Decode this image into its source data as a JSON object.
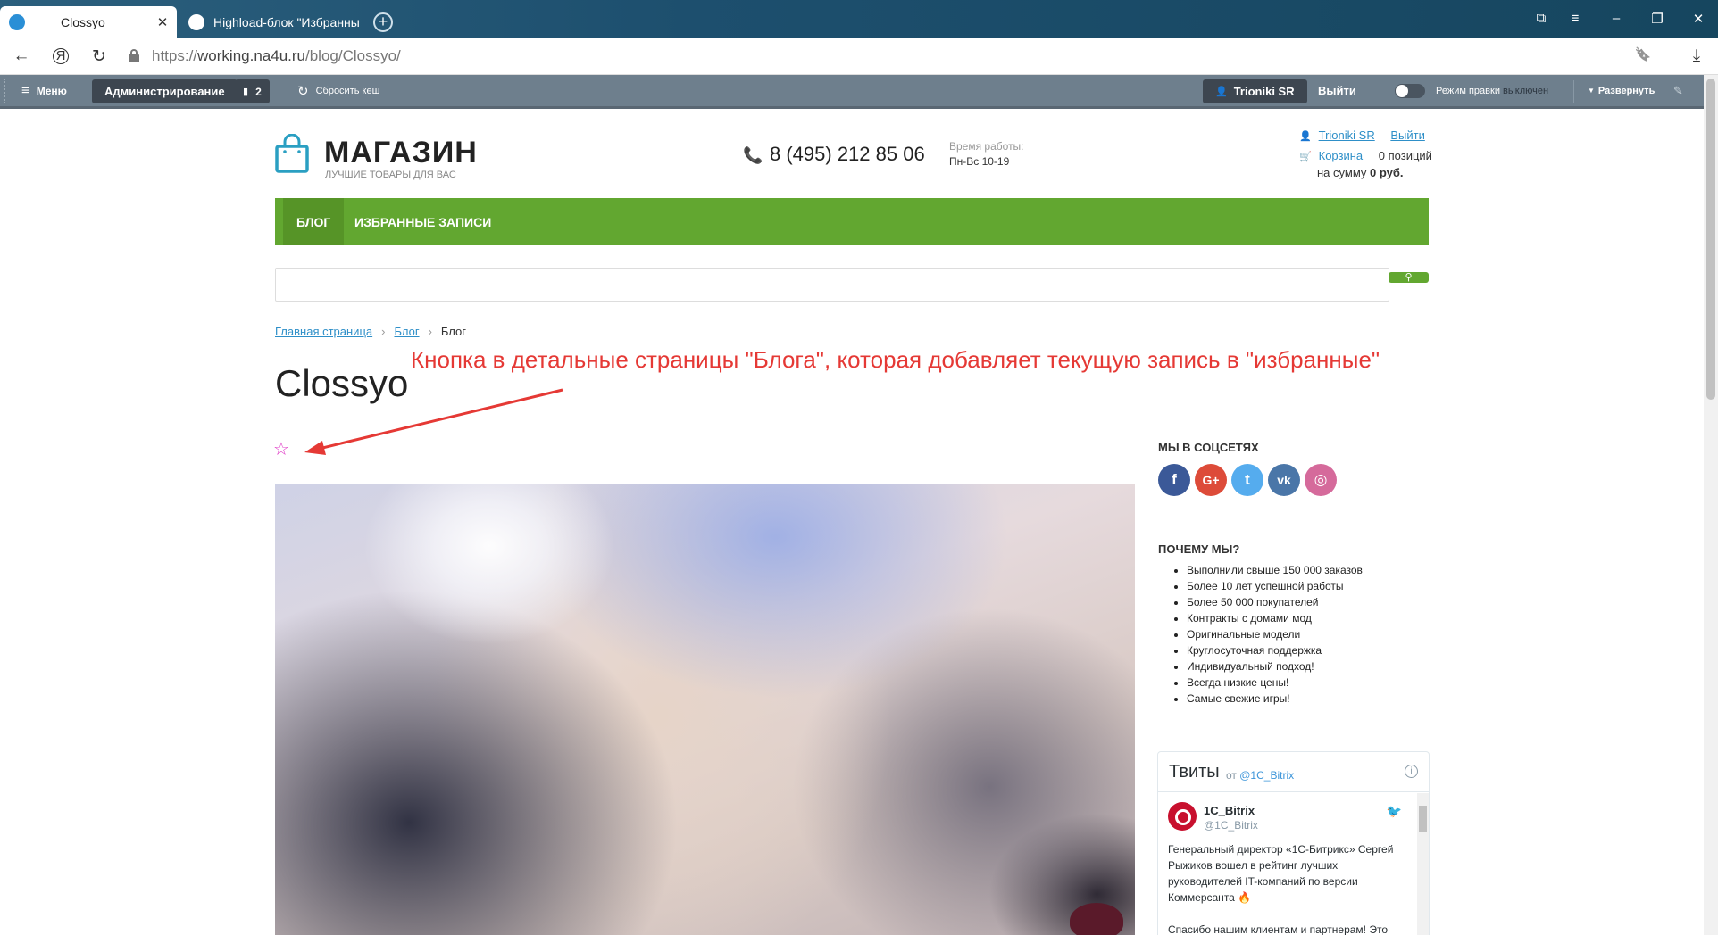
{
  "browser": {
    "tabs": [
      {
        "title": "Clossyo",
        "active": true
      },
      {
        "title": "Highload-блок \"Избранны",
        "active": false
      }
    ],
    "new_tab_label": "+",
    "url_protocol": "https://",
    "url_host": "working.na4u.ru",
    "url_path": "/blog/Clossyo/",
    "icons": [
      "back-arrow-icon",
      "yandex-icon",
      "reload-icon",
      "lock-icon",
      "bookmark-icon",
      "download-icon"
    ],
    "nav": {
      "back": "←",
      "yandex": "Я",
      "reload": "↻",
      "bookmark": "🔖",
      "download": "⤓"
    },
    "window": {
      "bookmarks": "⧉",
      "menu": "≡",
      "minimize": "–",
      "maximize": "❐",
      "close": "✕"
    }
  },
  "admin_panel": {
    "menu_label": "Меню",
    "admin_label": "Администрирование",
    "notifications_count": "2",
    "clear_cache_label": "Сбросить кеш",
    "user_label": "Trioniki SR",
    "logout_label": "Выйти",
    "edit_mode_label": "Режим правки",
    "edit_mode_state": "выключен",
    "expand_label": "Развернуть",
    "colors": {
      "bar": "#6e7f8d",
      "button": "#3d4650"
    }
  },
  "header": {
    "logo_title": "МАГАЗИН",
    "logo_subtitle": "ЛУЧШИЕ ТОВАРЫ ДЛЯ ВАС",
    "phone": "8 (495) 212 85 06",
    "hours_label": "Время работы:",
    "hours_value": "Пн-Вс 10-19",
    "user_link": "Trioniki SR",
    "logout_link": "Выйти",
    "cart_link": "Корзина",
    "cart_count": "0 позиций",
    "cart_sum_label": "на сумму",
    "cart_sum": "0 руб.",
    "accent_color": "#62a730"
  },
  "menu": {
    "items": [
      {
        "label": "БЛОГ",
        "active": true
      },
      {
        "label": "ИЗБРАННЫЕ ЗАПИСИ",
        "active": false
      }
    ]
  },
  "search": {
    "placeholder": "",
    "button_icon": "search-icon"
  },
  "breadcrumbs": [
    {
      "label": "Главная страница",
      "link": true
    },
    {
      "label": "Блог",
      "link": true
    },
    {
      "label": "Блог",
      "link": false
    }
  ],
  "breadcrumb_separator": "›",
  "annotation": "Кнопка в детальные страницы \"Блога\", которая добавляет текущую запись в \"избранные\"",
  "annotation_color": "#e53935",
  "post": {
    "title": "Clossyo",
    "favorite_icon": "☆",
    "favorite_color": "#e040c8"
  },
  "sidebar": {
    "social_heading": "МЫ В СОЦСЕТЯХ",
    "social": [
      {
        "name": "facebook-icon",
        "glyph": "f",
        "color": "#3b5998"
      },
      {
        "name": "google-plus-icon",
        "glyph": "G+",
        "color": "#dd4b39"
      },
      {
        "name": "twitter-icon",
        "glyph": "t",
        "color": "#55acee"
      },
      {
        "name": "vk-icon",
        "glyph": "vk",
        "color": "#4a76a8"
      },
      {
        "name": "instagram-icon",
        "glyph": "◎",
        "color": "#d56a9b"
      }
    ],
    "why_heading": "ПОЧЕМУ МЫ?",
    "why_items": [
      "Выполнили свыше 150 000 заказов",
      "Более 10 лет успешной работы",
      "Более 50 000 покупателей",
      "Контракты с домами мод",
      "Оригинальные модели",
      "Круглосуточная поддержка",
      "Индивидуальный подход!",
      "Всегда низкие цены!",
      "Самые свежие игры!"
    ]
  },
  "tweets": {
    "title": "Твиты",
    "from_label": "от",
    "from_handle": "@1C_Bitrix",
    "info_icon": "i",
    "bird_icon": "🐦",
    "author_name": "1C_Bitrix",
    "author_handle": "@1C_Bitrix",
    "text_1": "Генеральный директор «1С-Битрикс» Сергей Рыжиков вошел в рейтинг лучших руководителей IT-компаний по версии Коммерсанта 🔥",
    "text_2": "Спасибо нашим клиентам и партнерам! Это"
  }
}
